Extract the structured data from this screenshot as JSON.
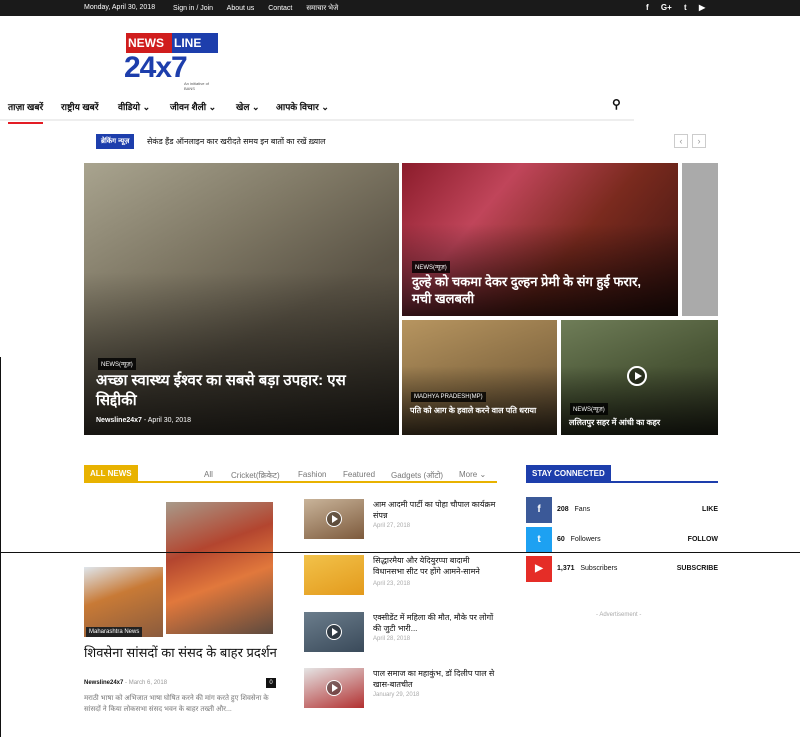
{
  "topbar": {
    "date": "Monday, April 30, 2018",
    "links": [
      "Sign in / Join",
      "About us",
      "Contact",
      "समाचार भेजे"
    ],
    "social_icons": [
      "f",
      "G+",
      "t",
      "▶"
    ]
  },
  "logo": {
    "line1a": "NEWS",
    "line1b": "LINE",
    "line2": "24x7",
    "tagline": "An initiative of BANS"
  },
  "nav": {
    "items": [
      "ताज़ा खबरें",
      "राष्ट्रीय खबरें",
      "वीडियो",
      "जीवन शैली",
      "खेल",
      "आपके विचार"
    ],
    "dropdown_marks": [
      "⌄",
      "⌄",
      "⌄",
      "⌄"
    ],
    "search_icon": "⚲"
  },
  "breaking": {
    "badge": "ब्रेकिंग न्यूज़",
    "headline": "सेकंड हैंड ऑनलाइन कार खरीदते समय इन बातों का रखें ख़्याल",
    "prev": "‹",
    "next": "›"
  },
  "tiles": {
    "t1": {
      "cat": "NEWS(न्यूज़)",
      "title": "अच्छा स्वास्थ्य ईश्वर का सबसे बड़ा उपहार: एस सिद्दीकी",
      "author": "Newsline24x7",
      "date": "April 30, 2018"
    },
    "t2": {
      "cat": "NEWS(न्यूज़)",
      "title": "दुल्हे को चकमा देकर दुल्हन प्रेमी के संग हुई फरार, मची खलबली"
    },
    "t3": {
      "cat": "MADHYA PRADESH(MP)",
      "title": "पति को आग के हवाले करने वाल पति धराया"
    },
    "t4": {
      "cat": "NEWS(न्यूज़)",
      "title": "ललितपुर सहर में आंधी का कहर"
    }
  },
  "all_news": {
    "label": "ALL NEWS",
    "tabs": [
      "All",
      "Cricket(क्रिकेट)",
      "Fashion",
      "Featured",
      "Gadgets (ऑटो)",
      "More"
    ]
  },
  "big_story": {
    "cat": "Maharashtra News",
    "title": "शिवसेना सांसदों का संसद के बाहर प्रदर्शन",
    "author": "Newsline24x7",
    "date": "March 6, 2018",
    "comments": "0",
    "excerpt": "मराठी भाषा को अभिजात भाषा घोषित करने की मांग करते हुए शिवसेना के सांसदों ने किया लोकसभा संसद भवन के बाहर तख्ती और..."
  },
  "news_list": [
    {
      "title": "आम आदमी पार्टी का पोहा चौपाल कार्यक्रम संपन्न",
      "date": "April 27, 2018",
      "video": true,
      "color": "#7d5a3c"
    },
    {
      "title": "सिद्धारमैया और येदियुरप्पा बादामी विधानसभा सीट पर होंगे आमने-सामने",
      "date": "April 23, 2018",
      "video": false,
      "color": "#e39a1c"
    },
    {
      "title": "एक्सीडेंट में महिला की मौत, मौके पर लोगों की जुटी भारी...",
      "date": "April 28, 2018",
      "video": true,
      "color": "#3a4a5a"
    },
    {
      "title": "पाल समाज का महाकुंभ, डॉ दिलीप पाल से खास-बातचीत",
      "date": "January 29, 2018",
      "video": true,
      "color": "#b23030"
    }
  ],
  "stay": {
    "label": "STAY CONNECTED",
    "rows": [
      {
        "icon": "f",
        "count": "208",
        "unit": "Fans",
        "action": "LIKE",
        "color": "#3b5998"
      },
      {
        "icon": "t",
        "count": "60",
        "unit": "Followers",
        "action": "FOLLOW",
        "color": "#1da1f2"
      },
      {
        "icon": "▶",
        "count": "1,371",
        "unit": "Subscribers",
        "action": "SUBSCRIBE",
        "color": "#e52d27"
      }
    ],
    "ad": "- Advertisement -"
  }
}
